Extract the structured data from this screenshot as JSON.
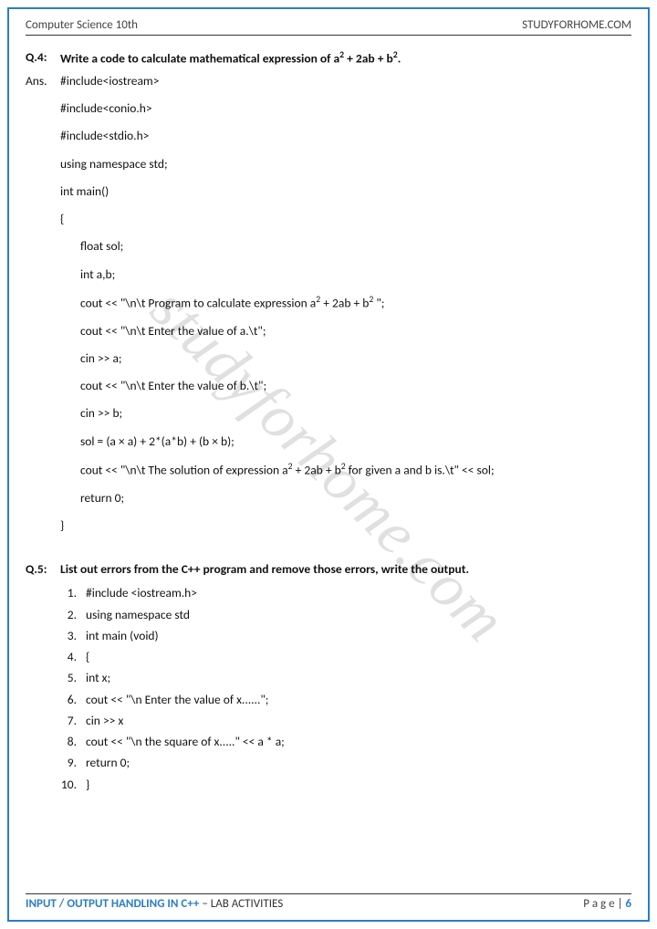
{
  "header": {
    "left": "Computer Science 10th",
    "right": "STUDYFORHOME.COM"
  },
  "watermark": "studyforhome.com",
  "q4": {
    "label": "Q.4:",
    "text_pre": "Write a code to calculate mathematical expression of a",
    "text_mid1": " + 2ab + b",
    "text_post": ".",
    "ans": "Ans.",
    "lines": {
      "l1": "#include<iostream>",
      "l2": "#include<conio.h>",
      "l3": "#include<stdio.h>",
      "l4": "using namespace std;",
      "l5": "int main()",
      "l6": "{",
      "l7": "float sol;",
      "l8": "int a,b;",
      "l9a": "cout << \"\\n\\t Program to calculate expression a",
      "l9b": " + 2ab + b",
      "l9c": " \";",
      "l10": "cout << \"\\n\\t Enter the value of a.\\t\";",
      "l11": "cin >> a;",
      "l12": "cout << \"\\n\\t Enter the value of b.\\t\";",
      "l13": "cin >> b;",
      "l14": "sol = (a × a) + 2*(a*b) + (b × b);",
      "l15a": "cout << \"\\n\\t The solution of expression a",
      "l15b": " + 2ab + b",
      "l15c": " for given a and b is.\\t\" << sol;",
      "l16": "return 0;",
      "l17": "}"
    }
  },
  "q5": {
    "label": "Q.5:",
    "text": "List out errors from the C++ program and remove those errors, write the output.",
    "items": {
      "n1": "1.",
      "c1": "#include <iostream.h>",
      "n2": "2.",
      "c2": "using namespace std",
      "n3": "3.",
      "c3": "int main (void)",
      "n4": "4.",
      "c4": "{",
      "n5": "5.",
      "c5": "int x;",
      "n6": "6.",
      "c6": "cout << \"\\n Enter the value of x......\";",
      "n7": "7.",
      "c7": "cin >> x",
      "n8": "8.",
      "c8": "cout << \"\\n the square of x.....\" << a * a;",
      "n9": "9.",
      "c9": "return 0;",
      "n10": "10.",
      "c10": "}"
    }
  },
  "footer": {
    "accent": "INPUT / OUTPUT HANDLING IN C++",
    "rest": " – LAB ACTIVITIES",
    "page_label": "P a g e  | ",
    "page_no": "6"
  }
}
